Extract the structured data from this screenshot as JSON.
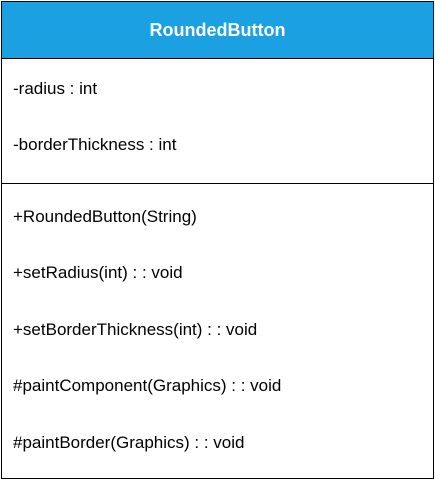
{
  "uml_class": {
    "name": "RoundedButton",
    "attributes": [
      "-radius : int",
      "-borderThickness : int"
    ],
    "methods": [
      "+RoundedButton(String)",
      "+setRadius(int) : : void",
      "+setBorderThickness(int) : : void",
      "#paintComponent(Graphics) : : void",
      "#paintBorder(Graphics) : : void"
    ]
  },
  "colors": {
    "header_fill": "#1ba1e2",
    "header_text": "#ffffff",
    "border": "#000000"
  }
}
